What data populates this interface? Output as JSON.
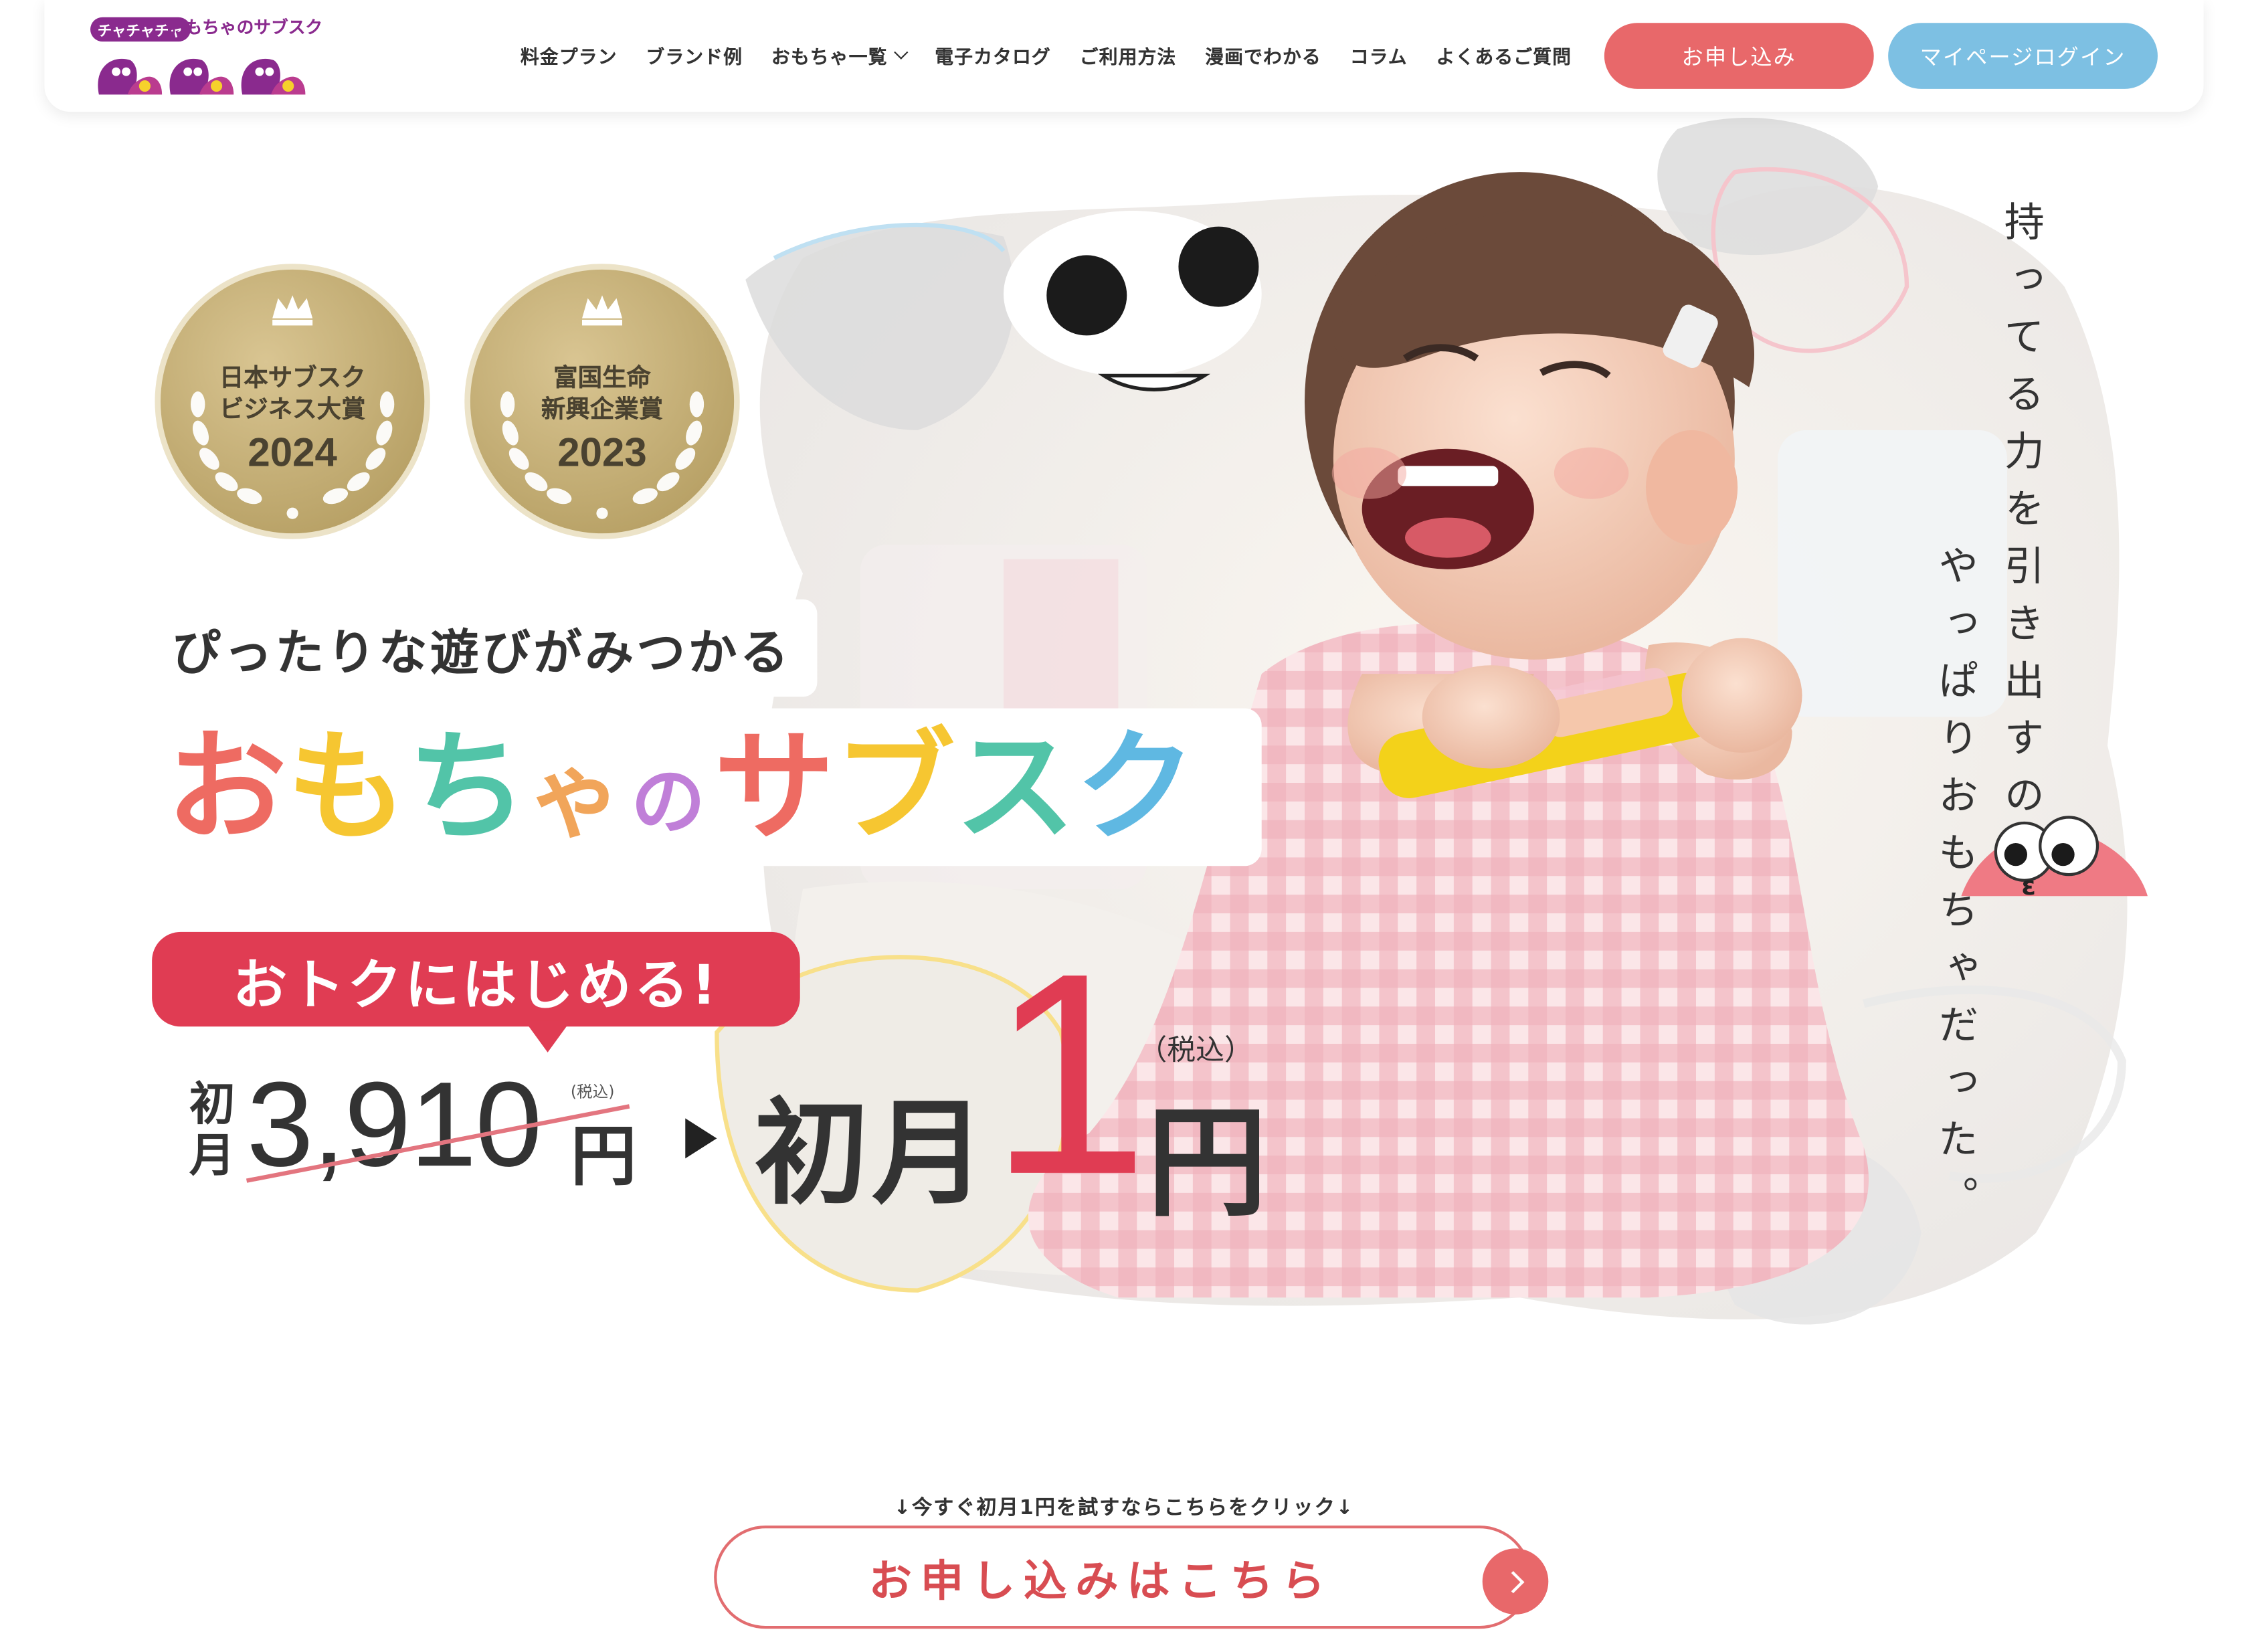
{
  "brand": {
    "logo_tag": "チャチャチャ",
    "logo_sub": "おもちゃのサブスク"
  },
  "nav": {
    "items": [
      {
        "label": "料金プラン"
      },
      {
        "label": "ブランド例"
      },
      {
        "label": "おもちゃ一覧"
      },
      {
        "label": "電子カタログ"
      },
      {
        "label": "ご利用方法"
      },
      {
        "label": "漫画でわかる"
      },
      {
        "label": "コラム"
      },
      {
        "label": "よくあるご質問"
      }
    ],
    "apply_label": "お申し込み",
    "login_label": "マイページログイン"
  },
  "awards": [
    {
      "line1": "日本サブスク",
      "line2": "ビジネス大賞",
      "year": "2024"
    },
    {
      "line1": "富国生命",
      "line2": "新興企業賞",
      "year": "2023"
    }
  ],
  "hero": {
    "tagline": "ぴったりな遊びがみつかる",
    "title": {
      "parts": [
        {
          "text": "お",
          "color": "#ee6b62"
        },
        {
          "text": "も",
          "color": "#f6c631"
        },
        {
          "text": "ち",
          "color": "#52c4a8"
        },
        {
          "text": "ゃ",
          "color": "#f1a55a"
        },
        {
          "text": "の",
          "color": "#c07fd8"
        },
        {
          "text": "サ",
          "color": "#ee6b62"
        },
        {
          "text": "ブ",
          "color": "#f6c631"
        },
        {
          "text": "ス",
          "color": "#52c4a8"
        },
        {
          "text": "ク",
          "color": "#5fb8e2"
        }
      ]
    },
    "bubble": "おトクにはじめる!",
    "price_orig_label": "初月",
    "price_orig": "3,910",
    "price_orig_yen": "円",
    "price_orig_tax": "(税込)",
    "price_new_label": "初月",
    "price_new": "1",
    "price_new_yen": "円",
    "price_new_tax": "（税込）",
    "vertical_copy_1": "持ってる力を引き出すの",
    "vertical_copy_2": "やっぱりおもちゃだった。"
  },
  "cta": {
    "note": "↓今すぐ初月1円を試すならこちらをクリック↓",
    "label": "お申し込みはこちら"
  },
  "colors": {
    "accent_red": "#e03c53",
    "button_coral": "#e8686a",
    "button_blue": "#7dc0e3",
    "gold": "#c8b178"
  }
}
